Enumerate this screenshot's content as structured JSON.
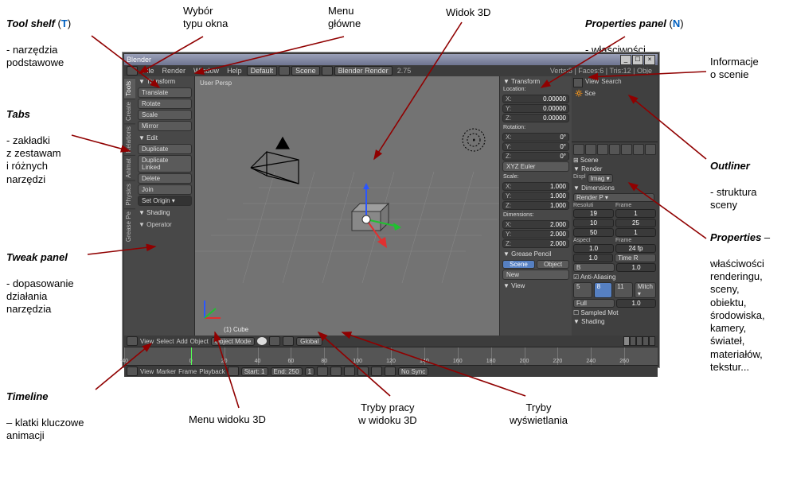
{
  "annotations": {
    "toolshelf": "Tool shelf",
    "toolshelf_key": "T",
    "toolshelf_desc": "- narzędzia\npodstawowe",
    "tabs": "Tabs",
    "tabs_desc": "- zakładki\nz zestawam\ni różnych\nnarzędzi",
    "tweak": "Tweak panel",
    "tweak_desc": "- dopasowanie\ndziałania\nnarzędzia",
    "timeline": "Timeline",
    "timeline_desc": "– klatki kluczowe\nanimacji",
    "editortype": "Wybór\ntypu okna",
    "mainmenu": "Menu\ngłówne",
    "view3d": "Widok 3D",
    "proppanel": "Properties panel",
    "proppanel_key": "N",
    "proppanel_desc": "- właściwości",
    "sceneinfo": "Informacje\no scenie",
    "outliner": "Outliner",
    "outliner_desc": "- struktura\nsceny",
    "properties": "Properties",
    "properties_desc": "właściwości\nrenderingu,\nsceny,\nobiektu,\nśrodowiska,\nkamery,\nświateł,\nmateriałów,\ntekstur...",
    "view3dmenu": "Menu widoku 3D",
    "workmodes": "Tryby pracy\nw widoku 3D",
    "dispmodes": "Tryby\nwyświetlania"
  },
  "blender": {
    "title": "Blender",
    "menu": {
      "file": "File",
      "render": "Render",
      "window": "Window",
      "help": "Help",
      "layout": "Default",
      "scene": "Scene",
      "engine": "Blender Render",
      "version": "2.75",
      "stats": "Verts:8 | Faces:6 | Tris:12 | Obje"
    },
    "tabs": [
      "Tools",
      "Create",
      "Relations",
      "Animat",
      "Physics",
      "Grease Pe"
    ],
    "toolshelf": {
      "transform_hdr": "▼ Transform",
      "translate": "Translate",
      "rotate": "Rotate",
      "scale": "Scale",
      "mirror": "Mirror",
      "edit_hdr": "▼ Edit",
      "duplicate": "Duplicate",
      "duplicate_linked": "Duplicate Linked",
      "delete": "Delete",
      "join": "Join",
      "set_origin": "Set Origin ▾",
      "shading_hdr": "▼ Shading",
      "operator": "▼ Operator"
    },
    "viewport": {
      "persp": "User Persp",
      "object_name": "(1) Cube"
    },
    "npanel": {
      "transform_hdr": "▼ Transform",
      "location": "Location:",
      "rotation": "Rotation:",
      "scale": "Scale:",
      "dimensions": "Dimensions:",
      "x": "X:",
      "y": "Y:",
      "z": "Z:",
      "loc": {
        "x": "0.00000",
        "y": "0.00000",
        "z": "0.00000"
      },
      "rot": {
        "x": "0°",
        "y": "0°",
        "z": "0°"
      },
      "rot_mode": "XYZ Euler",
      "scl": {
        "x": "1.000",
        "y": "1.000",
        "z": "1.000"
      },
      "dim": {
        "x": "2.000",
        "y": "2.000",
        "z": "2.000"
      },
      "grease_hdr": "▼ Grease Pencil",
      "gp_scene": "Scene",
      "gp_object": "Object",
      "gp_new": "New",
      "view_hdr": "▼ View"
    },
    "outliner": {
      "view": "View",
      "search": "Search",
      "scene": "Sce"
    },
    "props": {
      "scene_hdr": "⊞ Scene",
      "render_hdr": "▼ Render",
      "display": "Displ",
      "display_val": "Imag ▾",
      "dimensions_hdr": "▼ Dimensions",
      "preset": "Render P ▾",
      "resol": "Resoluti",
      "frame": "Frame",
      "rx": "19",
      "ry": "10",
      "rp": "50",
      "f1": "1",
      "f2": "25",
      "f3": "1",
      "aspect": "Aspect",
      "frame2": "Frame",
      "ax": "1.0",
      "ay": "1.0",
      "fps": "24 fp",
      "time": "Time R",
      "border": "B",
      "crop": "1.0",
      "aa_hdr": "☑ Anti-Aliasing",
      "aa5": "5",
      "aa8": "8",
      "aa11": "11",
      "mitch": "Mitch ▾",
      "full": "Full",
      "sz": "1.0",
      "sampled_hdr": "☐ Sampled Mot",
      "shading_hdr": "▼ Shading"
    },
    "vheader": {
      "view": "View",
      "select": "Select",
      "add": "Add",
      "object": "Object",
      "mode": "Object Mode",
      "orient": "Global"
    },
    "timeline": {
      "start": -40,
      "end": 280,
      "current": 0,
      "ticks": [
        -40,
        0,
        20,
        40,
        60,
        80,
        100,
        120,
        140,
        160,
        180,
        200,
        220,
        240,
        260
      ]
    },
    "thdr": {
      "view": "View",
      "marker": "Marker",
      "frame": "Frame",
      "playback": "Playback",
      "start_lbl": "Start:",
      "start": "1",
      "end_lbl": "End:",
      "end": "250",
      "cur": "1",
      "sync": "No Sync"
    }
  }
}
